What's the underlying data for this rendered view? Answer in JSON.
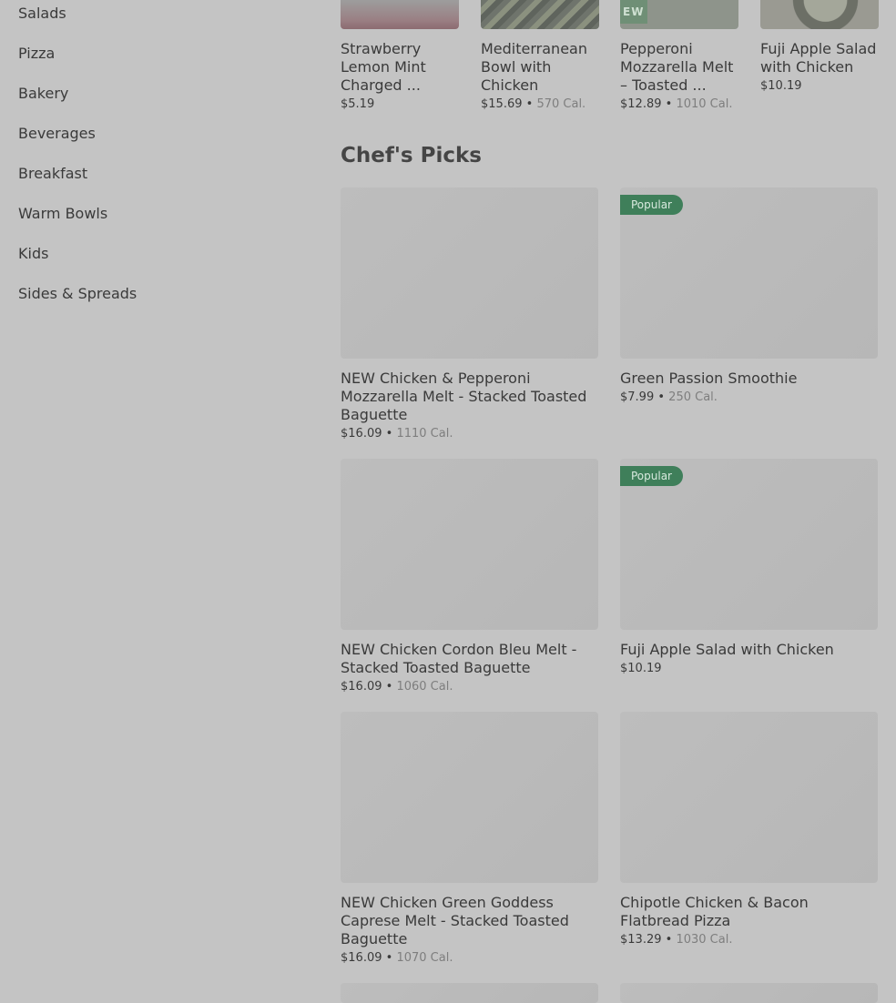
{
  "sidebar": {
    "items": [
      {
        "label": "Salads"
      },
      {
        "label": "Pizza"
      },
      {
        "label": "Bakery"
      },
      {
        "label": "Beverages"
      },
      {
        "label": "Breakfast"
      },
      {
        "label": "Warm Bowls"
      },
      {
        "label": "Kids"
      },
      {
        "label": "Sides & Spreads"
      }
    ]
  },
  "carousel": [
    {
      "name": "Strawberry Lemon Mint Charged ...",
      "name_lines": [
        "Strawberry",
        "Lemon Mint",
        "Charged ..."
      ],
      "price": "$5.19",
      "cal": ""
    },
    {
      "name_lines": [
        "Mediterranean",
        "Bowl with",
        "Chicken"
      ],
      "price": "$15.69",
      "cal": "570 Cal."
    },
    {
      "name_lines": [
        "Pepperoni",
        "Mozzarella Melt",
        "– Toasted ..."
      ],
      "price": "$12.89",
      "cal": "1010 Cal.",
      "badge": "EW"
    },
    {
      "name_lines": [
        "Fuji Apple Salad",
        "with Chicken"
      ],
      "price": "$10.19",
      "cal": ""
    }
  ],
  "section": {
    "title": "Chef's Picks"
  },
  "items": [
    {
      "name": "NEW Chicken & Pepperoni Mozzarella Melt - Stacked Toasted Baguette",
      "price": "$16.09",
      "sep": "•",
      "cal": "1110 Cal.",
      "badge": ""
    },
    {
      "name": "Green Passion Smoothie",
      "price": "$7.99",
      "sep": "•",
      "cal": "250 Cal.",
      "badge": "Popular"
    },
    {
      "name": "NEW Chicken Cordon Bleu Melt - Stacked Toasted Baguette",
      "price": "$16.09",
      "sep": "•",
      "cal": "1060 Cal.",
      "badge": ""
    },
    {
      "name": "Fuji Apple Salad with Chicken",
      "price": "$10.19",
      "sep": "",
      "cal": "",
      "badge": "Popular"
    },
    {
      "name": "NEW Chicken Green Goddess Caprese Melt - Stacked Toasted Baguette",
      "price": "$16.09",
      "sep": "•",
      "cal": "1070 Cal.",
      "badge": ""
    },
    {
      "name": "Chipotle Chicken & Bacon Flatbread Pizza",
      "price": "$13.29",
      "sep": "•",
      "cal": "1030 Cal.",
      "badge": ""
    }
  ]
}
